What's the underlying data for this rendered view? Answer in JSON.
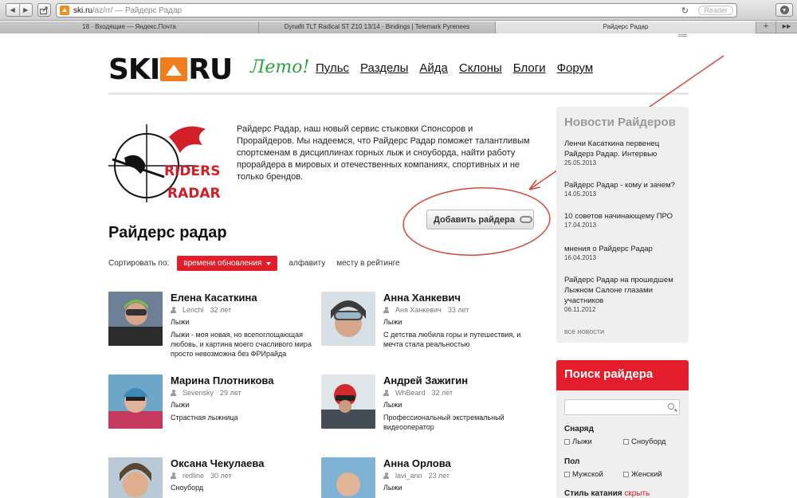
{
  "browser": {
    "url_host": "ski.ru",
    "url_path": "/az/rr/ — Райдерс Радар",
    "reader_label": "Reader",
    "tabs": [
      {
        "label": "18 · Входящие — Яндекс.Почта"
      },
      {
        "label": "Dynafit TLT Radical ST Z10 13/14 · Bindings | Telemark Pyrenees"
      },
      {
        "label": "Райдерс Радар"
      }
    ],
    "new_tab_label": "+"
  },
  "header": {
    "logo_left": "SKI",
    "logo_right": "RU",
    "leto": "Лето!",
    "nav": [
      "Пульс",
      "Разделы",
      "Айда",
      "Склоны",
      "Блоги",
      "Форум"
    ]
  },
  "intro": {
    "logo_text_1": "RIDERS",
    "logo_text_2": "RADAR",
    "text": "Райдерс Радар, наш новый сервис стыковки Спонсоров и Прорайдеров. Мы надеемся, что Райдерс Радар поможет талантливым спортсменам в дисциплинах горных лыж и сноуборда, найти работу прорайдера в мировых и отечественных компаниях, спортивных и не только брендов."
  },
  "add_rider_label": "Добавить райдера",
  "page_title": "Райдерс радар",
  "sort": {
    "label": "Сортировать по:",
    "active": "времени обновления",
    "options": [
      "алфавиту",
      "месту в рейтинге"
    ]
  },
  "riders": [
    {
      "name": "Елена Касаткина",
      "login": "Lenchi",
      "age": "32 лет",
      "sport": "Лыжи",
      "bio": "Лыжи - моя новая, но всепоглощающая любовь, и картина моего счасливого мира просто невозможна без ФРИрайда"
    },
    {
      "name": "Анна Ханкевич",
      "login": "Аня Ханкевич",
      "age": "33 лет",
      "sport": "Лыжи",
      "bio": "С детства любила горы и путешествия, и мечта стала реальностью"
    },
    {
      "name": "Марина Плотникова",
      "login": "Sevensky",
      "age": "29 лет",
      "sport": "Лыжи",
      "bio": "Страстная лыжница"
    },
    {
      "name": "Андрей Зажигин",
      "login": "WhBeard",
      "age": "32 лет",
      "sport": "Лыжи",
      "bio": "Профессиональный экстремальный видеооператор"
    },
    {
      "name": "Оксана Чекулаева",
      "login": "redline",
      "age": "30 лет",
      "sport": "Сноуборд",
      "bio": ""
    },
    {
      "name": "Анна Орлова",
      "login": "lavi_ann",
      "age": "23 лет",
      "sport": "Лыжи",
      "bio": ""
    }
  ],
  "news": {
    "title": "Новости Райдеров",
    "items": [
      {
        "title": "Ленчи Касаткина первенец Райдерз Радар. Интервью",
        "date": "25.05.2013"
      },
      {
        "title": "Райдерс Радар - кому и зачем?",
        "date": "14.05.2013"
      },
      {
        "title": "10 советов начинающему ПРО",
        "date": "17.04.2013"
      },
      {
        "title": "мнения о Райдерс Радар",
        "date": "16.04.2013"
      },
      {
        "title": "Райдерс Радар на прошедшем Лыжном Салоне глазами участников",
        "date": "06.11.2012"
      }
    ],
    "all_link": "все новости"
  },
  "search": {
    "title": "Поиск райдера",
    "gear_label": "Снаряд",
    "gear_options": [
      "Лыжи",
      "Сноуборд"
    ],
    "gender_label": "Пол",
    "gender_options": [
      "Мужской",
      "Женский"
    ],
    "style_label": "Стиль катания",
    "hide_link": "скрыть"
  },
  "colors": {
    "accent_red": "#e31e2c",
    "logo_orange": "#f07e1c",
    "leto_green": "#2aa33b"
  }
}
